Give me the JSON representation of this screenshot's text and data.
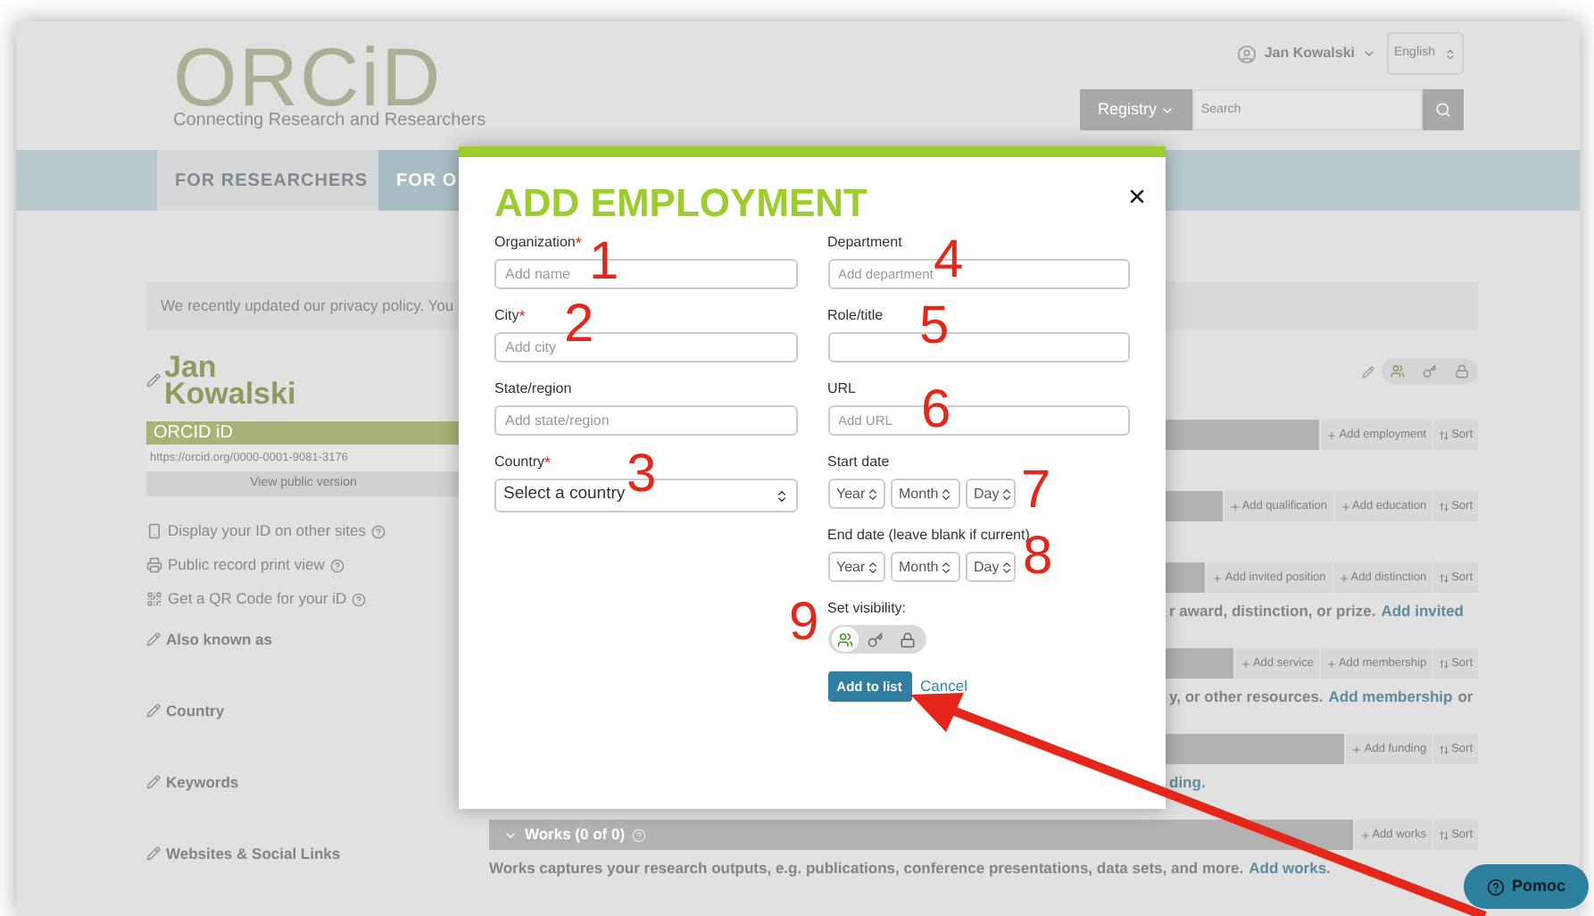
{
  "header": {
    "logo": "ORCiD",
    "tagline": "Connecting Research and Researchers",
    "user": "Jan Kowalski",
    "language": "English",
    "registry_button": "Registry",
    "search": {
      "placeholder": "Search"
    }
  },
  "nav_tabs": [
    {
      "label": "FOR RESEARCHERS",
      "selected": true
    },
    {
      "label": "FOR O",
      "selected": false
    }
  ],
  "notice": "We recently updated our privacy policy. You",
  "profile": {
    "name": "Jan Kowalski",
    "orcid_heading": "ORCID iD",
    "orcid_url": "https://orcid.org/0000-0001-9081-3176",
    "public_version": "View public version",
    "links": [
      {
        "kind": "display",
        "label": "Display your ID on other sites"
      },
      {
        "kind": "print",
        "label": "Public record print view"
      },
      {
        "kind": "qr",
        "label": "Get a QR Code for your iD"
      }
    ],
    "sections": [
      "Also known as",
      "Country",
      "Keywords",
      "Websites & Social Links"
    ]
  },
  "activity_sections": [
    {
      "buttons": [
        "Add employment",
        "Sort"
      ]
    },
    {
      "buttons": [
        "Add qualification",
        "Add education",
        "Sort"
      ]
    },
    {
      "buttons": [
        "Add invited position",
        "Add distinction",
        "Sort"
      ],
      "note": "r award, distinction, or prize.",
      "note_link": "Add invited"
    },
    {
      "buttons": [
        "Add service",
        "Add membership",
        "Sort"
      ],
      "note": "y, or other resources.",
      "note_link": "Add membership",
      "note_tail": "or"
    },
    {
      "buttons": [
        "Add funding",
        "Sort"
      ],
      "note_link": "ding."
    },
    {
      "title": "Works (0 of 0)",
      "buttons": [
        "Add works",
        "Sort"
      ],
      "note": "Works captures your research outputs, e.g. publications, conference presentations, data sets, and more.",
      "note_link": "Add works."
    }
  ],
  "modal": {
    "title": "ADD EMPLOYMENT",
    "left_fields": [
      {
        "label": "Organization",
        "required_mark": "*",
        "kind": "text",
        "placeholder": "Add name"
      },
      {
        "label": "City",
        "required_mark": "*",
        "kind": "text",
        "placeholder": "Add city"
      },
      {
        "label": "State/region",
        "kind": "text",
        "placeholder": "Add state/region"
      },
      {
        "label": "Country",
        "required_mark": "*",
        "kind": "select",
        "value": "Select a country"
      }
    ],
    "right_fields": [
      {
        "label": "Department",
        "kind": "text",
        "placeholder": "Add department"
      },
      {
        "label": "Role/title",
        "kind": "text"
      },
      {
        "label": "URL",
        "kind": "text",
        "placeholder": "Add URL"
      },
      {
        "label": "Start date",
        "kind": "date",
        "parts": [
          "Year",
          "Month",
          "Day"
        ]
      },
      {
        "label": "End date (leave blank if current)",
        "kind": "date",
        "parts": [
          "Year",
          "Month",
          "Day"
        ]
      }
    ],
    "visibility_label": "Set visibility:",
    "visibility": [
      {
        "kind": "public",
        "selected": true
      },
      {
        "kind": "trusted",
        "selected": false
      },
      {
        "kind": "private",
        "selected": false
      }
    ],
    "add_button": "Add to list",
    "cancel": "Cancel"
  },
  "help_button": "Pomoc",
  "annotations": [
    "1",
    "2",
    "4",
    "5",
    "6",
    "3",
    "7",
    "8",
    "9"
  ]
}
